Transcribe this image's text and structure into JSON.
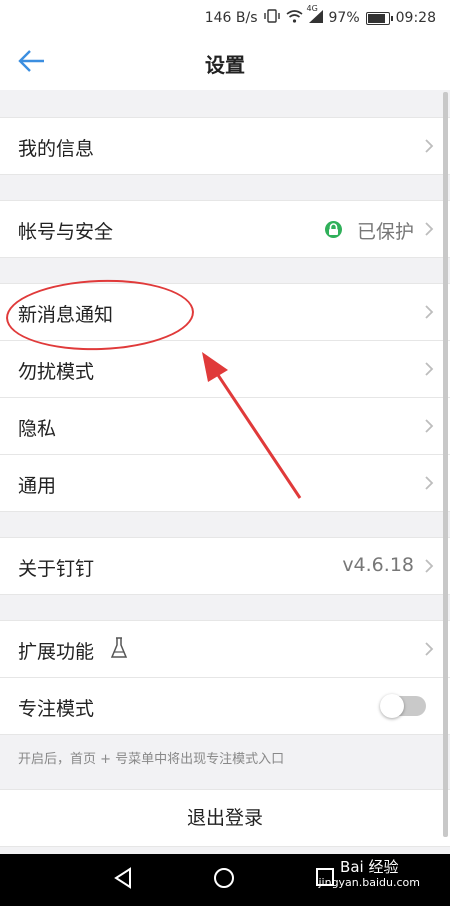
{
  "status_bar": {
    "speed": "146 B/s",
    "network": "4G",
    "battery_percent": "97%",
    "battery_level": 0.97,
    "time": "09:28"
  },
  "nav": {
    "title": "设置",
    "back_icon": "arrow-left-icon"
  },
  "rows": {
    "my_info": "我的信息",
    "account_security": "帐号与安全",
    "protected": "已保护",
    "new_message": "新消息通知",
    "do_not_disturb": "勿扰模式",
    "privacy": "隐私",
    "general": "通用",
    "about": "关于钉钉",
    "version": "v4.6.18",
    "extensions": "扩展功能",
    "focus_mode": "专注模式"
  },
  "focus_hint": "开启后，首页 + 号菜单中将出现专注模式入口",
  "logout": "退出登录",
  "watermark": {
    "line1": "Bai 经验",
    "line2": "jingyan.baidu.com"
  },
  "colors": {
    "accent": "#3b8ee0",
    "annotation": "#e03a3a",
    "protected": "#30b05a"
  }
}
